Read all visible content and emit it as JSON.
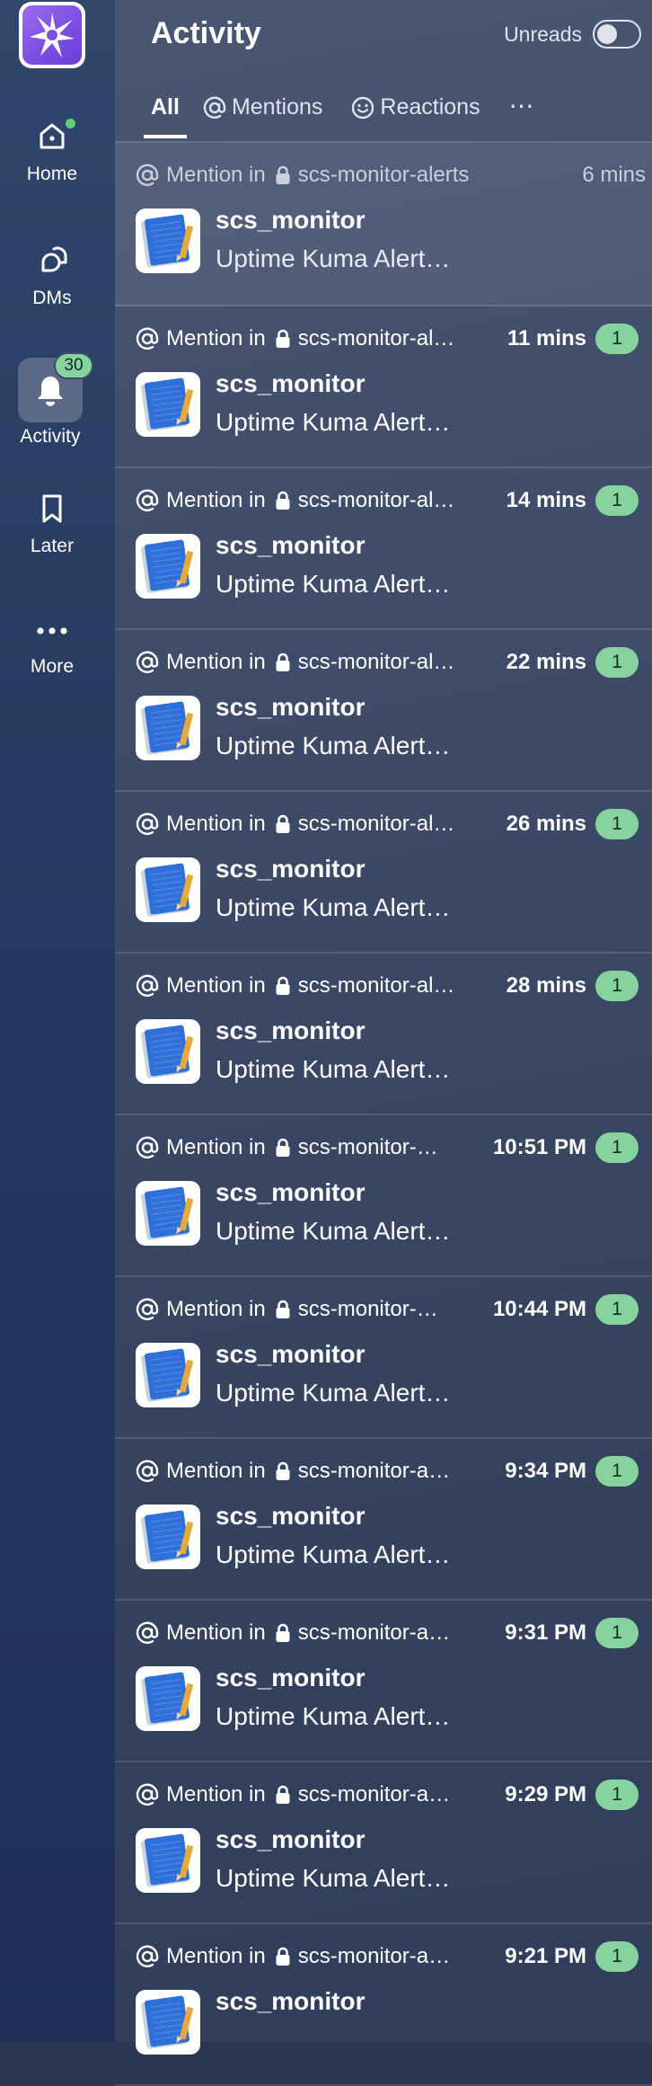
{
  "sidebar": {
    "logo_icon": "workspace-star-logo",
    "items": [
      {
        "label": "Home",
        "icon": "home-icon"
      },
      {
        "label": "DMs",
        "icon": "dms-icon"
      },
      {
        "label": "Activity",
        "icon": "bell-icon",
        "badge": "30",
        "active": true
      },
      {
        "label": "Later",
        "icon": "bookmark-icon"
      },
      {
        "label": "More",
        "icon": "more-dots-icon"
      }
    ]
  },
  "header": {
    "title": "Activity",
    "unreads_label": "Unreads",
    "unreads_enabled": false
  },
  "tabs": [
    {
      "label": "All",
      "active": true
    },
    {
      "label": "Mentions",
      "icon": "at-icon"
    },
    {
      "label": "Reactions",
      "icon": "smiley-icon"
    },
    {
      "label": "⋯",
      "icon": "more-horizontal-icon"
    }
  ],
  "feed": [
    {
      "mention": "Mention in",
      "channel": "scs-monitor-alerts",
      "time": "6 mins",
      "sender": "scs_monitor",
      "preview": "Uptime Kuma Alert…",
      "badge": ""
    },
    {
      "mention": "Mention in",
      "channel": "scs-monitor-al…",
      "time": "11 mins",
      "sender": "scs_monitor",
      "preview": "Uptime Kuma Alert…",
      "badge": "1"
    },
    {
      "mention": "Mention in",
      "channel": "scs-monitor-al…",
      "time": "14 mins",
      "sender": "scs_monitor",
      "preview": "Uptime Kuma Alert…",
      "badge": "1"
    },
    {
      "mention": "Mention in",
      "channel": "scs-monitor-al…",
      "time": "22 mins",
      "sender": "scs_monitor",
      "preview": "Uptime Kuma Alert…",
      "badge": "1"
    },
    {
      "mention": "Mention in",
      "channel": "scs-monitor-al…",
      "time": "26 mins",
      "sender": "scs_monitor",
      "preview": "Uptime Kuma Alert…",
      "badge": "1"
    },
    {
      "mention": "Mention in",
      "channel": "scs-monitor-al…",
      "time": "28 mins",
      "sender": "scs_monitor",
      "preview": "Uptime Kuma Alert…",
      "badge": "1"
    },
    {
      "mention": "Mention in",
      "channel": "scs-monitor-…",
      "time": "10:51 PM",
      "sender": "scs_monitor",
      "preview": "Uptime Kuma Alert…",
      "badge": "1"
    },
    {
      "mention": "Mention in",
      "channel": "scs-monitor-…",
      "time": "10:44 PM",
      "sender": "scs_monitor",
      "preview": "Uptime Kuma Alert…",
      "badge": "1"
    },
    {
      "mention": "Mention in",
      "channel": "scs-monitor-a…",
      "time": "9:34 PM",
      "sender": "scs_monitor",
      "preview": "Uptime Kuma Alert…",
      "badge": "1"
    },
    {
      "mention": "Mention in",
      "channel": "scs-monitor-a…",
      "time": "9:31 PM",
      "sender": "scs_monitor",
      "preview": "Uptime Kuma Alert…",
      "badge": "1"
    },
    {
      "mention": "Mention in",
      "channel": "scs-monitor-a…",
      "time": "9:29 PM",
      "sender": "scs_monitor",
      "preview": "Uptime Kuma Alert…",
      "badge": "1"
    },
    {
      "mention": "Mention in",
      "channel": "scs-monitor-a…",
      "time": "9:21 PM",
      "sender": "scs_monitor",
      "preview": "",
      "badge": "1"
    }
  ],
  "colors": {
    "badge_green": "#86d3a0",
    "presence_green": "#5cd27a",
    "logo_purple": "#7c4fe3",
    "avatar_blue": "#2f6fd8",
    "avatar_pencil": "#e6a93b"
  }
}
